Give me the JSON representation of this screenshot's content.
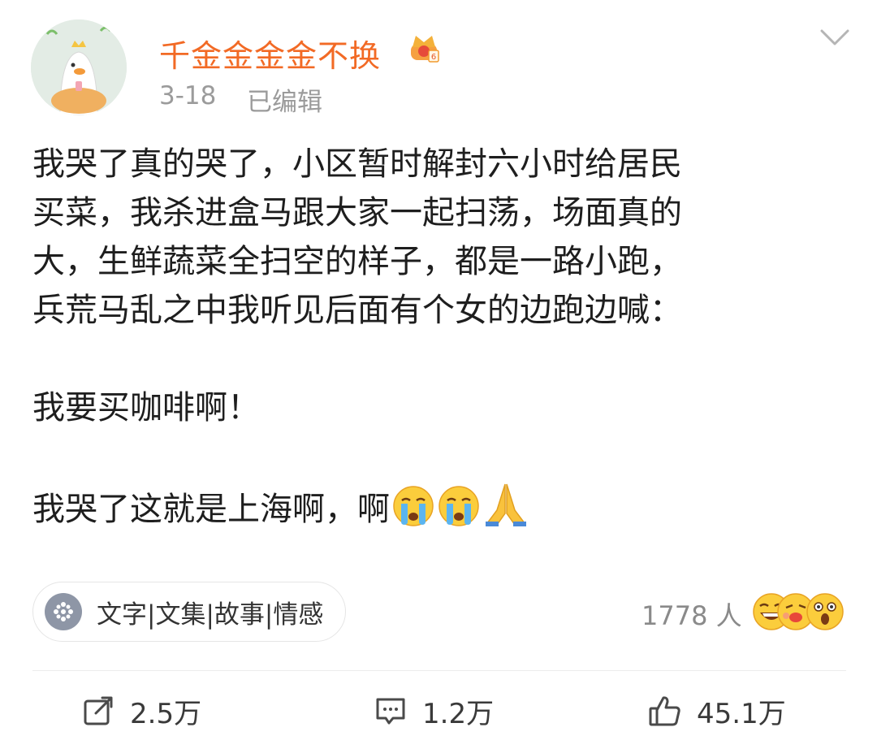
{
  "user": {
    "name": "千金金金金不换",
    "date": "3-18",
    "edited_label": "已编辑",
    "name_color": "#f26a25",
    "badge_icon": "crown-icon"
  },
  "post": {
    "lines": [
      "我哭了真的哭了，小区暂时解封六小时给居民",
      "买菜，我杀进盒马跟大家一起扫荡，场面真的",
      "大，生鲜蔬菜全扫空的样子，都是一路小跑，",
      "兵荒马乱之中我听见后面有个女的边跑边喊："
    ],
    "quote": "我要买咖啡啊！",
    "closing": "我哭了这就是上海啊，啊",
    "closing_emojis": [
      "crying-emoji",
      "crying-emoji",
      "pray-emoji"
    ]
  },
  "topic": {
    "label": "文字|文集|故事|情感",
    "icon": "topic-icon"
  },
  "reactions": {
    "count_label": "1778 人",
    "emojis": [
      "laughing-emoji",
      "kiss-emoji",
      "surprised-emoji"
    ]
  },
  "actions": {
    "repost": "2.5万",
    "comment": "1.2万",
    "like": "45.1万"
  }
}
